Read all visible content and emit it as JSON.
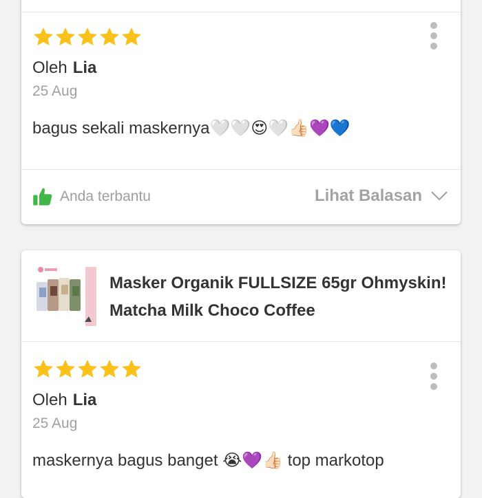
{
  "reviews": [
    {
      "rating": 5,
      "by_prefix": "Oleh",
      "author": "Lia",
      "date": "25 Aug",
      "text": "bagus sekali maskernya🤍🤍😍🤍👍🏻💜💙",
      "helpful_label": "Anda terbantu",
      "replies_label": "Lihat Balasan"
    },
    {
      "rating": 5,
      "product_title": "Masker Organik FULLSIZE 65gr Ohmyskin! Matcha Milk Choco Coffee",
      "by_prefix": "Oleh",
      "author": "Lia",
      "date": "25 Aug",
      "text": "maskernya bagus banget 😭💜👍🏻 top markotop"
    }
  ],
  "colors": {
    "star": "#f9c11a",
    "helpful_icon": "#43b649",
    "muted_text": "#a0a0a0"
  },
  "icons": {
    "star": "star-icon",
    "more": "more-vertical-icon",
    "helpful": "thumbs-up-icon",
    "expand": "chevron-down-icon"
  }
}
